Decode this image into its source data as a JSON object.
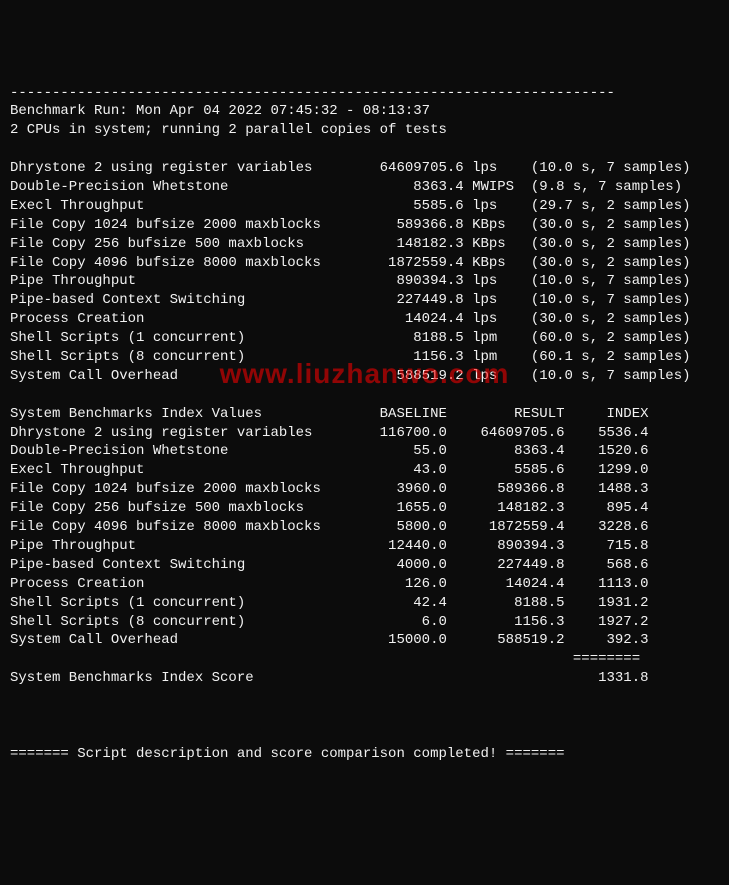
{
  "header": {
    "divider_top": "------------------------------------------------------------------------",
    "run_line": "Benchmark Run: Mon Apr 04 2022 07:45:32 - 08:13:37",
    "cpu_line": "2 CPUs in system; running 2 parallel copies of tests"
  },
  "results": [
    {
      "name": "Dhrystone 2 using register variables",
      "value": "64609705.6",
      "unit": "lps",
      "timing": "(10.0 s, 7 samples)"
    },
    {
      "name": "Double-Precision Whetstone",
      "value": "8363.4",
      "unit": "MWIPS",
      "timing": "(9.8 s, 7 samples)"
    },
    {
      "name": "Execl Throughput",
      "value": "5585.6",
      "unit": "lps",
      "timing": "(29.7 s, 2 samples)"
    },
    {
      "name": "File Copy 1024 bufsize 2000 maxblocks",
      "value": "589366.8",
      "unit": "KBps",
      "timing": "(30.0 s, 2 samples)"
    },
    {
      "name": "File Copy 256 bufsize 500 maxblocks",
      "value": "148182.3",
      "unit": "KBps",
      "timing": "(30.0 s, 2 samples)"
    },
    {
      "name": "File Copy 4096 bufsize 8000 maxblocks",
      "value": "1872559.4",
      "unit": "KBps",
      "timing": "(30.0 s, 2 samples)"
    },
    {
      "name": "Pipe Throughput",
      "value": "890394.3",
      "unit": "lps",
      "timing": "(10.0 s, 7 samples)"
    },
    {
      "name": "Pipe-based Context Switching",
      "value": "227449.8",
      "unit": "lps",
      "timing": "(10.0 s, 7 samples)"
    },
    {
      "name": "Process Creation",
      "value": "14024.4",
      "unit": "lps",
      "timing": "(30.0 s, 2 samples)"
    },
    {
      "name": "Shell Scripts (1 concurrent)",
      "value": "8188.5",
      "unit": "lpm",
      "timing": "(60.0 s, 2 samples)"
    },
    {
      "name": "Shell Scripts (8 concurrent)",
      "value": "1156.3",
      "unit": "lpm",
      "timing": "(60.1 s, 2 samples)"
    },
    {
      "name": "System Call Overhead",
      "value": "588519.2",
      "unit": "lps",
      "timing": "(10.0 s, 7 samples)"
    }
  ],
  "index_header": {
    "label": "System Benchmarks Index Values",
    "baseline": "BASELINE",
    "result": "RESULT",
    "index": "INDEX"
  },
  "index_rows": [
    {
      "name": "Dhrystone 2 using register variables",
      "baseline": "116700.0",
      "result": "64609705.6",
      "index": "5536.4"
    },
    {
      "name": "Double-Precision Whetstone",
      "baseline": "55.0",
      "result": "8363.4",
      "index": "1520.6"
    },
    {
      "name": "Execl Throughput",
      "baseline": "43.0",
      "result": "5585.6",
      "index": "1299.0"
    },
    {
      "name": "File Copy 1024 bufsize 2000 maxblocks",
      "baseline": "3960.0",
      "result": "589366.8",
      "index": "1488.3"
    },
    {
      "name": "File Copy 256 bufsize 500 maxblocks",
      "baseline": "1655.0",
      "result": "148182.3",
      "index": "895.4"
    },
    {
      "name": "File Copy 4096 bufsize 8000 maxblocks",
      "baseline": "5800.0",
      "result": "1872559.4",
      "index": "3228.6"
    },
    {
      "name": "Pipe Throughput",
      "baseline": "12440.0",
      "result": "890394.3",
      "index": "715.8"
    },
    {
      "name": "Pipe-based Context Switching",
      "baseline": "4000.0",
      "result": "227449.8",
      "index": "568.6"
    },
    {
      "name": "Process Creation",
      "baseline": "126.0",
      "result": "14024.4",
      "index": "1113.0"
    },
    {
      "name": "Shell Scripts (1 concurrent)",
      "baseline": "42.4",
      "result": "8188.5",
      "index": "1931.2"
    },
    {
      "name": "Shell Scripts (8 concurrent)",
      "baseline": "6.0",
      "result": "1156.3",
      "index": "1927.2"
    },
    {
      "name": "System Call Overhead",
      "baseline": "15000.0",
      "result": "588519.2",
      "index": "392.3"
    }
  ],
  "score_divider": "                                                                   ========",
  "score_line": {
    "label": "System Benchmarks Index Score",
    "value": "1331.8"
  },
  "footer": {
    "line": "======= Script description and score comparison completed! ======="
  },
  "watermark": "www.liuzhanwo.com"
}
